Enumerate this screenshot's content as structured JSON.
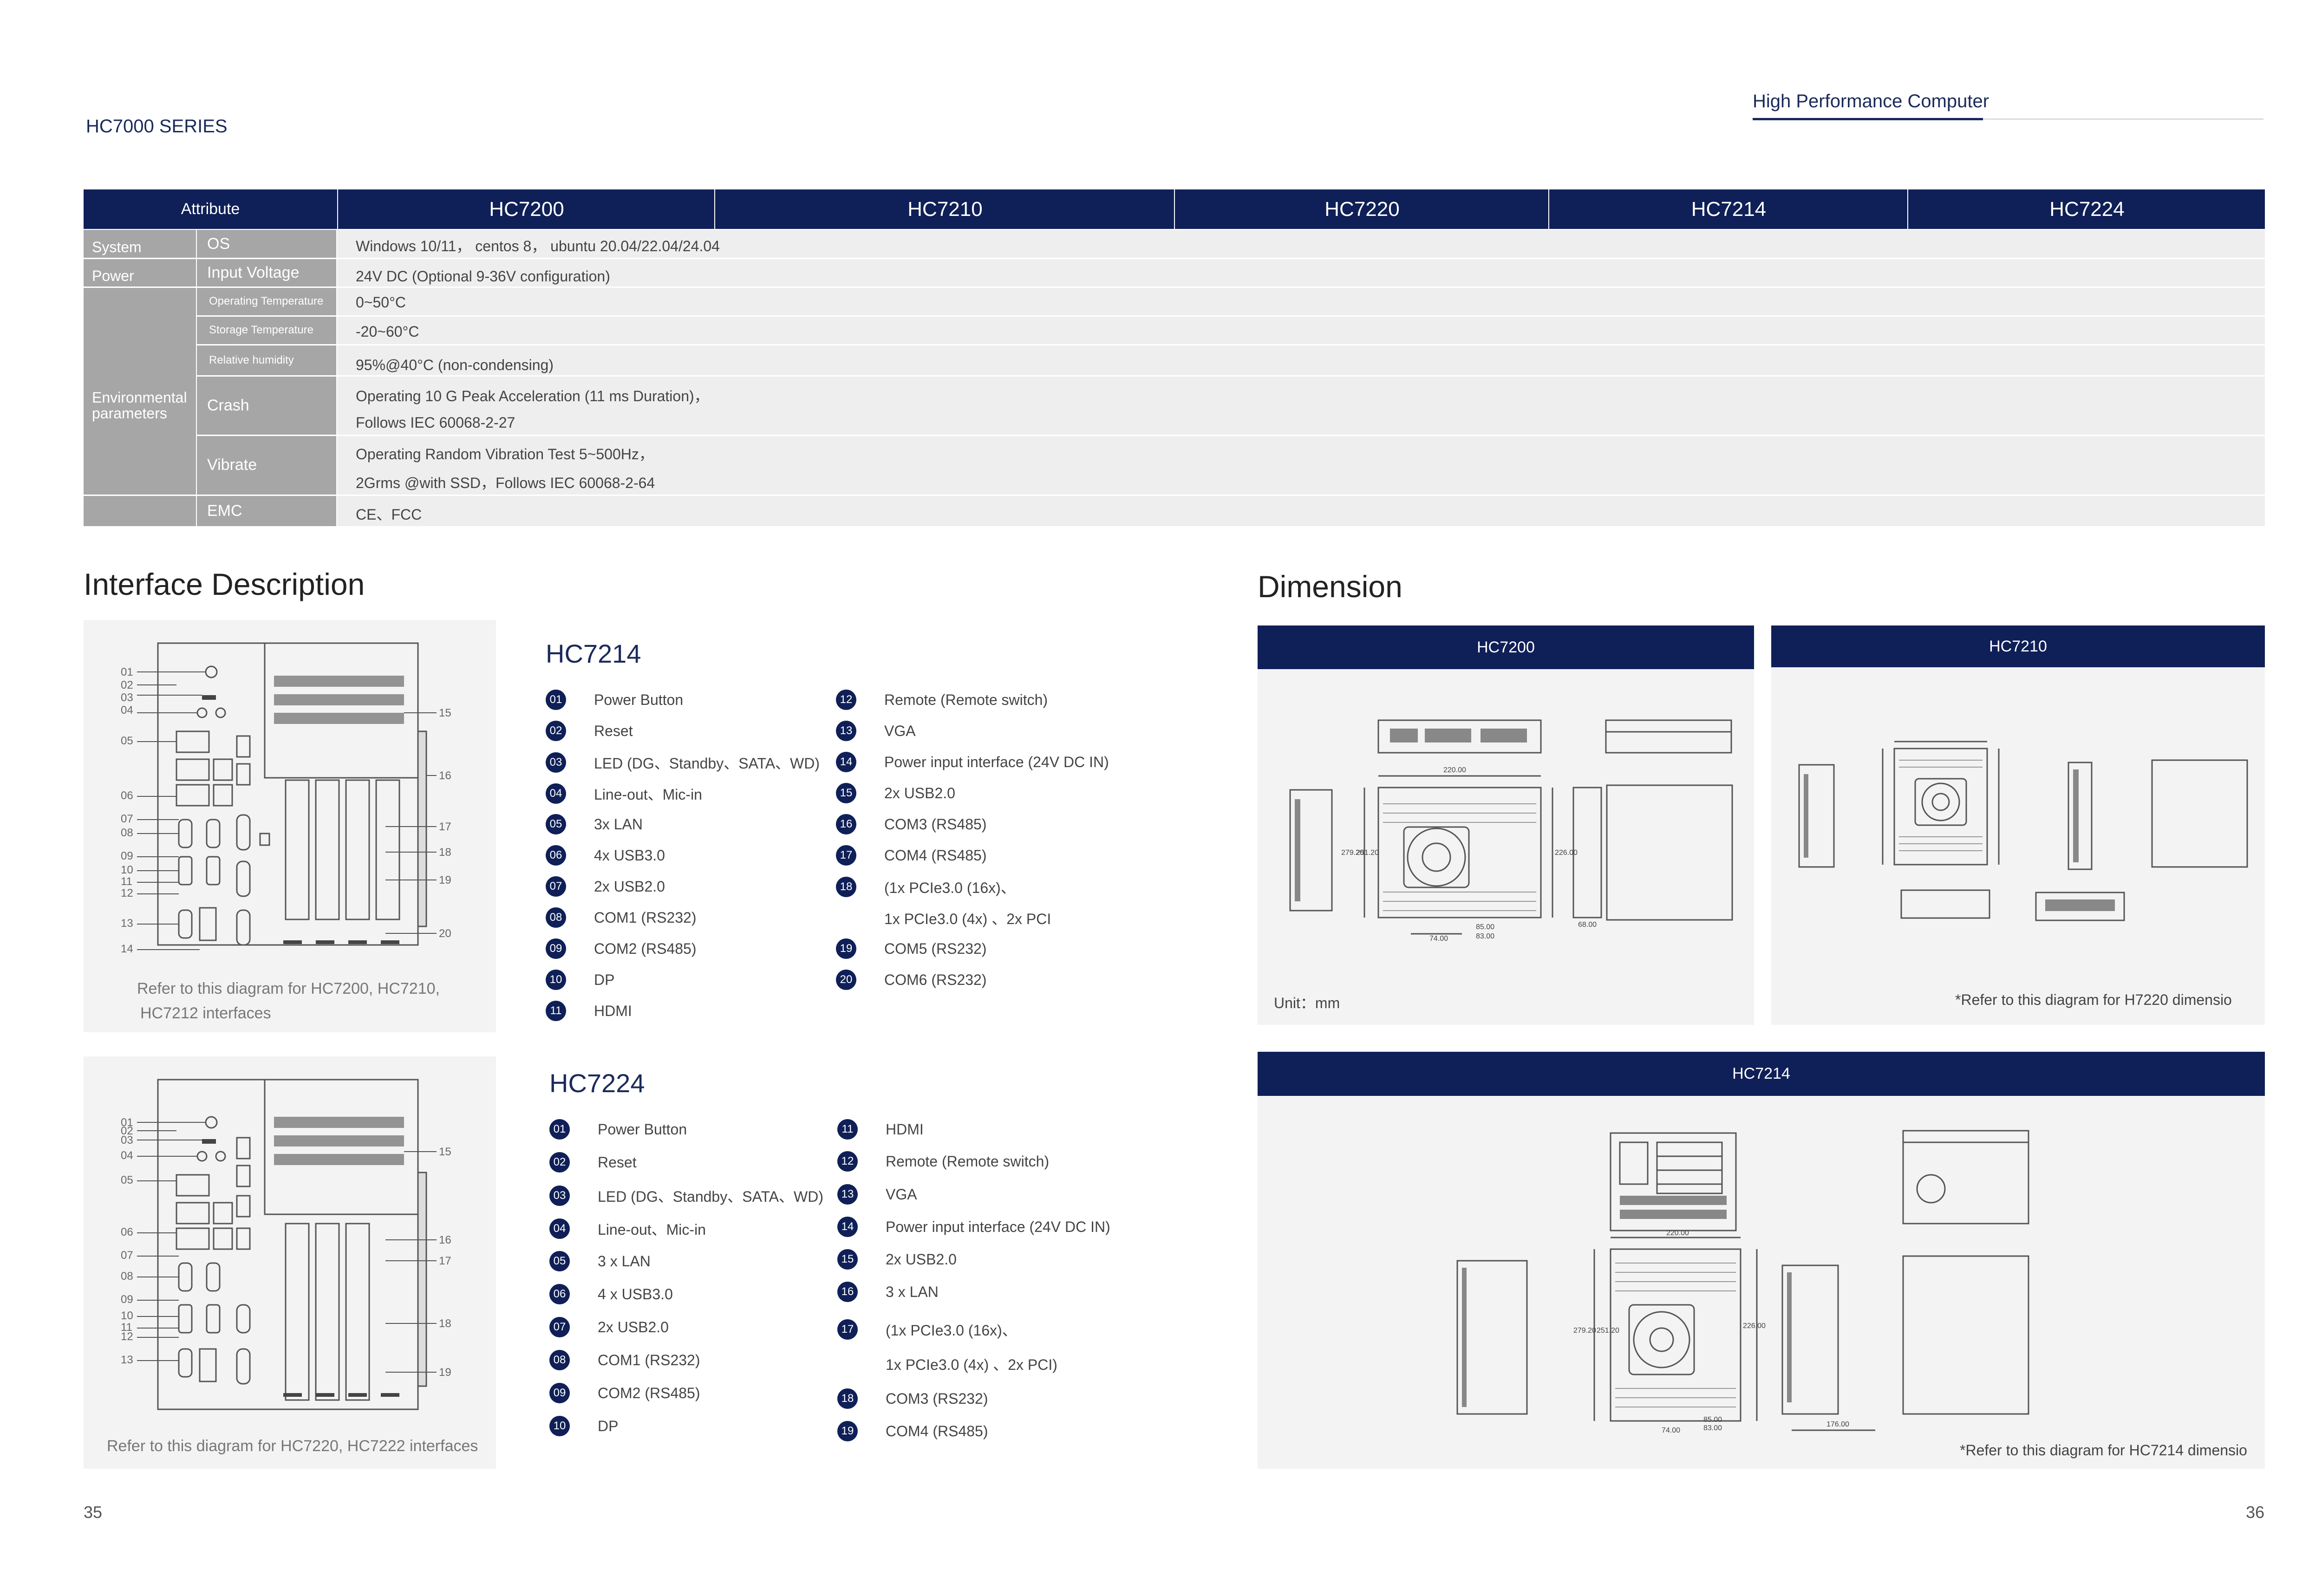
{
  "header": {
    "series": "HC7000 SERIES",
    "brand": "High Performance Computer"
  },
  "table": {
    "attribute_label": "Attribute",
    "models": [
      "HC7200",
      "HC7210",
      "HC7220",
      "HC7214",
      "HC7224"
    ],
    "rows": {
      "system": {
        "category": "System",
        "attribute": "OS",
        "value": "Windows 10/11， centos 8， ubuntu 20.04/22.04/24.04"
      },
      "power": {
        "category": "Power",
        "attribute": "Input Voltage",
        "value": "24V DC (Optional 9-36V configuration)"
      },
      "environmental_category": "Environmental parameters",
      "operating_temperature": {
        "attribute": "Operating Temperature",
        "value": "0~50°C"
      },
      "storage_temperature": {
        "attribute": "Storage Temperature",
        "value": "-20~60°C"
      },
      "relative_humidity": {
        "attribute": "Relative humidity",
        "value": "95%@40°C (non-condensing)"
      },
      "crash": {
        "attribute": "Crash",
        "value_line1": "Operating 10 G Peak Acceleration (11 ms Duration)，",
        "value_line2": "Follows IEC 60068-2-27"
      },
      "vibrate": {
        "attribute": "Vibrate",
        "value_line1": "Operating Random Vibration Test 5~500Hz，",
        "value_line2": "2Grms @with SSD，Follows IEC 60068-2-64"
      },
      "emc": {
        "attribute": "EMC",
        "value": "CE、FCC"
      }
    }
  },
  "interface": {
    "title": "Interface Description",
    "diagram1": {
      "left_labels": [
        "01",
        "02",
        "03",
        "04",
        "05",
        "06",
        "07",
        "08",
        "09",
        "10",
        "11",
        "12",
        "13",
        "14"
      ],
      "right_labels": [
        "15",
        "16",
        "17",
        "18",
        "19",
        "20"
      ],
      "caption_line1": "Refer to this diagram for HC7200, HC7210,",
      "caption_line2": "HC7212 interfaces"
    },
    "diagram2": {
      "left_labels": [
        "01",
        "02",
        "03",
        "04",
        "05",
        "06",
        "07",
        "08",
        "09",
        "10",
        "11",
        "12",
        "13"
      ],
      "right_labels": [
        "15",
        "16",
        "17",
        "18",
        "19"
      ],
      "caption": "Refer to this diagram for HC7220, HC7222 interfaces"
    },
    "hc7214": {
      "title": "HC7214",
      "left": [
        {
          "num": "01",
          "text": "Power Button"
        },
        {
          "num": "02",
          "text": "Reset"
        },
        {
          "num": "03",
          "text": "LED (DG、Standby、SATA、WD)"
        },
        {
          "num": "04",
          "text": "Line-out、Mic-in"
        },
        {
          "num": "05",
          "text": "3x LAN"
        },
        {
          "num": "06",
          "text": "4x USB3.0"
        },
        {
          "num": "07",
          "text": "2x USB2.0"
        },
        {
          "num": "08",
          "text": "COM1 (RS232)"
        },
        {
          "num": "09",
          "text": "COM2 (RS485)"
        },
        {
          "num": "10",
          "text": "DP"
        },
        {
          "num": "11",
          "text": "HDMI"
        }
      ],
      "right": [
        {
          "num": "12",
          "text": "Remote (Remote switch)"
        },
        {
          "num": "13",
          "text": "VGA"
        },
        {
          "num": "14",
          "text": "Power input interface (24V DC IN)"
        },
        {
          "num": "15",
          "text": "2x USB2.0"
        },
        {
          "num": "16",
          "text": "COM3 (RS485)"
        },
        {
          "num": "17",
          "text": "COM4 (RS485)"
        },
        {
          "num": "18",
          "text": "(1x PCIe3.0 (16x)、"
        },
        {
          "num": "",
          "text": "1x PCIe3.0 (4x) 、2x PCI"
        },
        {
          "num": "19",
          "text": "COM5 (RS232)"
        },
        {
          "num": "20",
          "text": "COM6 (RS232)"
        }
      ]
    },
    "hc7224": {
      "title": "HC7224",
      "left": [
        {
          "num": "01",
          "text": "Power Button"
        },
        {
          "num": "02",
          "text": "Reset"
        },
        {
          "num": "03",
          "text": "LED (DG、Standby、SATA、WD)"
        },
        {
          "num": "04",
          "text": "Line-out、Mic-in"
        },
        {
          "num": "05",
          "text": "3 x LAN"
        },
        {
          "num": "06",
          "text": "4 x USB3.0"
        },
        {
          "num": "07",
          "text": "2x USB2.0"
        },
        {
          "num": "08",
          "text": "COM1 (RS232)"
        },
        {
          "num": "09",
          "text": "COM2 (RS485)"
        },
        {
          "num": "10",
          "text": "DP"
        }
      ],
      "right": [
        {
          "num": "11",
          "text": "HDMI"
        },
        {
          "num": "12",
          "text": "Remote (Remote switch)"
        },
        {
          "num": "13",
          "text": "VGA"
        },
        {
          "num": "14",
          "text": "Power input interface (24V DC IN)"
        },
        {
          "num": "15",
          "text": "2x USB2.0"
        },
        {
          "num": "16",
          "text": "3 x LAN"
        },
        {
          "num": "17",
          "text": "(1x PCIe3.0 (16x)、"
        },
        {
          "num": "",
          "text": "1x PCIe3.0 (4x) 、2x PCI)"
        },
        {
          "num": "18",
          "text": "COM3 (RS232)"
        },
        {
          "num": "19",
          "text": "COM4 (RS485)"
        }
      ]
    }
  },
  "dimension": {
    "title": "Dimension",
    "hc7200_label": "HC7200",
    "hc7210_label": "HC7210",
    "hc7214_label": "HC7214",
    "unit": "Unit：mm",
    "note_h7220": "*Refer to this diagram for H7220 dimensio",
    "note_hc7214": "*Refer to this diagram for HC7214 dimensio",
    "drawing_labels": {
      "d220": "220.00",
      "d226": "226.00",
      "d279": "279.20",
      "d251": "251.20",
      "d74": "74.00",
      "d85": "85.00",
      "d83": "83.00",
      "d68": "68.00",
      "d176": "176.00"
    }
  },
  "footer": {
    "page_left": "35",
    "page_right": "36"
  }
}
